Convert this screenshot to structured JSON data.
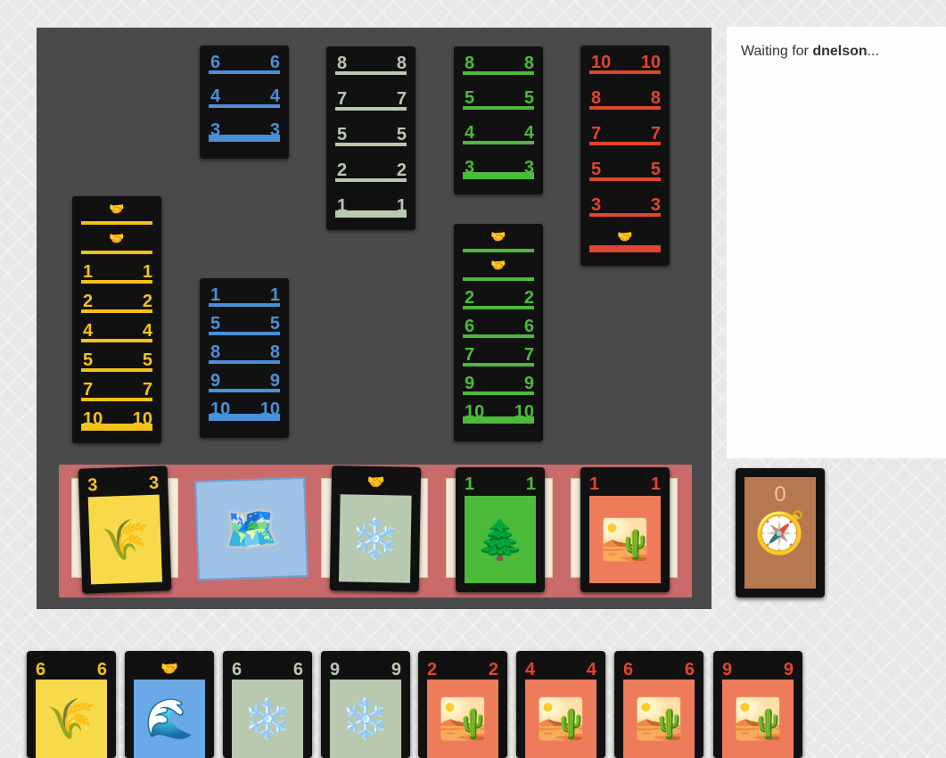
{
  "status": {
    "prefix": "Waiting for ",
    "player": "dnelson",
    "suffix": "..."
  },
  "colors": {
    "blue": "#4a90d9",
    "white": "#b9c9b0",
    "green": "#4cba3a",
    "red": "#e0452f",
    "yellow": "#f2c21b",
    "board": "#4a4a4a",
    "track": "#c96b6b"
  },
  "icons": {
    "handshake": "🤝",
    "wheat": "🌾",
    "map": "🗺️",
    "snow": "❄️",
    "tree": "🌲",
    "desert": "🏜️",
    "wave": "🌊",
    "compass": "🧭"
  },
  "opponent_stacks": {
    "blue": [
      "6",
      "4",
      "3"
    ],
    "white": [
      "8",
      "7",
      "5",
      "2",
      "1"
    ],
    "green": [
      "8",
      "5",
      "4",
      "3"
    ],
    "red": [
      "10",
      "8",
      "7",
      "5",
      "3",
      "🤝"
    ]
  },
  "player_stacks": {
    "yellow": [
      "🤝",
      "🤝",
      "1",
      "2",
      "4",
      "5",
      "7",
      "10"
    ],
    "blue": [
      "1",
      "5",
      "8",
      "9",
      "10"
    ],
    "green": [
      "🤝",
      "🤝",
      "2",
      "6",
      "7",
      "9",
      "10"
    ]
  },
  "discard_piles": [
    {
      "color": "yellow",
      "value": "3",
      "icon": "🌾"
    },
    {
      "color": "blue",
      "value": "",
      "icon": "🗺️"
    },
    {
      "color": "white",
      "value": "🤝",
      "icon": "❄️"
    },
    {
      "color": "green",
      "value": "1",
      "icon": "🌲"
    },
    {
      "color": "red",
      "value": "1",
      "icon": "🏜️"
    }
  ],
  "deck": {
    "count": "0",
    "icon": "🧭"
  },
  "hand": [
    {
      "color": "yellow",
      "value": "6",
      "icon": "🌾"
    },
    {
      "color": "blue",
      "value": "🤝",
      "icon": "🌊"
    },
    {
      "color": "white",
      "value": "6",
      "icon": "❄️"
    },
    {
      "color": "white",
      "value": "9",
      "icon": "❄️"
    },
    {
      "color": "red",
      "value": "2",
      "icon": "🏜️"
    },
    {
      "color": "red",
      "value": "4",
      "icon": "🏜️"
    },
    {
      "color": "red",
      "value": "6",
      "icon": "🏜️"
    },
    {
      "color": "red",
      "value": "9",
      "icon": "🏜️"
    }
  ]
}
